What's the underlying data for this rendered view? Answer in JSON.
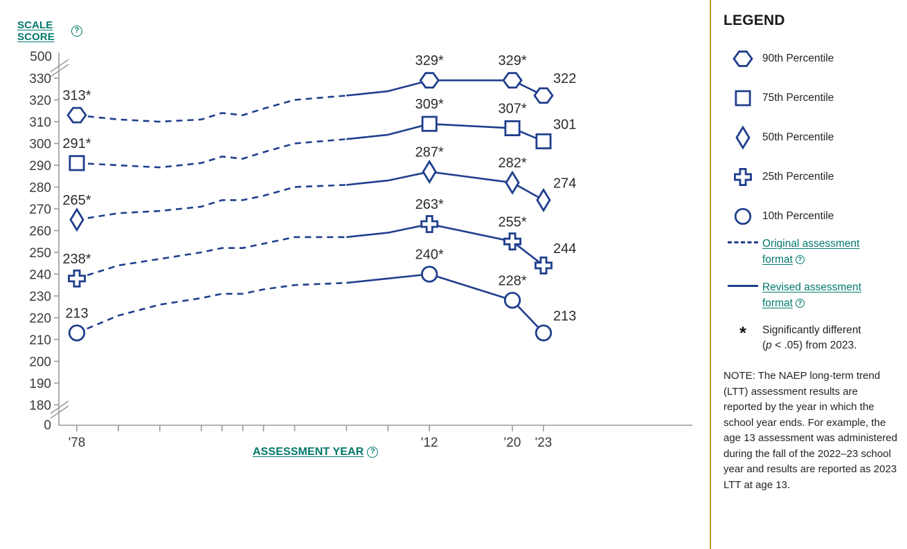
{
  "yaxis": {
    "title_line1": "SCALE",
    "title_line2": "SCORE",
    "help_icon": "question-circle-icon"
  },
  "xaxis": {
    "title": "ASSESSMENT YEAR",
    "help_icon": "question-circle-icon"
  },
  "legend": {
    "title": "LEGEND",
    "markers": [
      {
        "label": "90th Percentile",
        "shape": "hexagon"
      },
      {
        "label": "75th Percentile",
        "shape": "square"
      },
      {
        "label": "50th Percentile",
        "shape": "diamond"
      },
      {
        "label": "25th Percentile",
        "shape": "cross"
      },
      {
        "label": "10th Percentile",
        "shape": "circle"
      }
    ],
    "formats": [
      {
        "label_line1": "Original assessment",
        "label_line2": "format",
        "style": "dashed"
      },
      {
        "label_line1": "Revised assessment",
        "label_line2": "format",
        "style": "solid"
      }
    ],
    "significance": {
      "symbol": "*",
      "line1": "Significantly different",
      "line2_pre": "(",
      "line2_em": "p",
      "line2_post": " < .05) from 2023."
    },
    "note": "NOTE: The NAEP long-term trend (LTT) assessment results are reported by the year in which the school year ends. For example, the age 13 assessment was administered during the fall of the 2022–23 school year and results are reported as 2023 LTT at age 13."
  },
  "colors": {
    "series": "#1F3E8C",
    "axis": "#9a9a9a",
    "tick_label": "#3a3a3a",
    "data_label": "#2b2b2b",
    "link": "#00786B",
    "legend_border": "#C69A2E"
  },
  "chart_data": {
    "type": "line",
    "title": "",
    "xlabel": "ASSESSMENT YEAR",
    "ylabel": "SCALE SCORE",
    "ylim": [
      180,
      330
    ],
    "y_ticks": [
      330,
      320,
      310,
      300,
      290,
      280,
      270,
      260,
      250,
      240,
      230,
      220,
      210,
      200,
      190,
      180
    ],
    "y_top_label": "500",
    "y_zero_label": "0",
    "axis_breaks": [
      "between 500 and 330",
      "between 180 and 0"
    ],
    "grid": false,
    "legend_position": "right",
    "x_tick_labels": [
      "'78",
      "'12",
      "'20",
      "'23"
    ],
    "x_labeled_years": [
      1978,
      2012,
      2020,
      2023
    ],
    "series": [
      {
        "name": "90th Percentile",
        "shape": "hexagon",
        "points": [
          {
            "year": 1978,
            "value": 313,
            "label": "313*",
            "sig": true,
            "marker": true,
            "format": "original"
          },
          {
            "year": 1982,
            "value": 311,
            "format": "original"
          },
          {
            "year": 1986,
            "value": 310,
            "format": "original"
          },
          {
            "year": 1990,
            "value": 311,
            "format": "original"
          },
          {
            "year": 1992,
            "value": 314,
            "format": "original"
          },
          {
            "year": 1994,
            "value": 313,
            "format": "original"
          },
          {
            "year": 1996,
            "value": 316,
            "format": "original"
          },
          {
            "year": 1999,
            "value": 320,
            "format": "original"
          },
          {
            "year": 2004,
            "value": 322,
            "format": "revised"
          },
          {
            "year": 2008,
            "value": 324,
            "format": "revised"
          },
          {
            "year": 2012,
            "value": 329,
            "label": "329*",
            "sig": true,
            "marker": true,
            "format": "revised"
          },
          {
            "year": 2020,
            "value": 329,
            "label": "329*",
            "sig": true,
            "marker": true,
            "format": "revised"
          },
          {
            "year": 2023,
            "value": 322,
            "label": "322",
            "sig": false,
            "marker": true,
            "format": "revised"
          }
        ]
      },
      {
        "name": "75th Percentile",
        "shape": "square",
        "points": [
          {
            "year": 1978,
            "value": 291,
            "label": "291*",
            "sig": true,
            "marker": true,
            "format": "original"
          },
          {
            "year": 1982,
            "value": 290,
            "format": "original"
          },
          {
            "year": 1986,
            "value": 289,
            "format": "original"
          },
          {
            "year": 1990,
            "value": 291,
            "format": "original"
          },
          {
            "year": 1992,
            "value": 294,
            "format": "original"
          },
          {
            "year": 1994,
            "value": 293,
            "format": "original"
          },
          {
            "year": 1996,
            "value": 296,
            "format": "original"
          },
          {
            "year": 1999,
            "value": 300,
            "format": "original"
          },
          {
            "year": 2004,
            "value": 302,
            "format": "revised"
          },
          {
            "year": 2008,
            "value": 304,
            "format": "revised"
          },
          {
            "year": 2012,
            "value": 309,
            "label": "309*",
            "sig": true,
            "marker": true,
            "format": "revised"
          },
          {
            "year": 2020,
            "value": 307,
            "label": "307*",
            "sig": true,
            "marker": true,
            "format": "revised"
          },
          {
            "year": 2023,
            "value": 301,
            "label": "301",
            "sig": false,
            "marker": true,
            "format": "revised"
          }
        ]
      },
      {
        "name": "50th Percentile",
        "shape": "diamond",
        "points": [
          {
            "year": 1978,
            "value": 265,
            "label": "265*",
            "sig": true,
            "marker": true,
            "format": "original"
          },
          {
            "year": 1982,
            "value": 268,
            "format": "original"
          },
          {
            "year": 1986,
            "value": 269,
            "format": "original"
          },
          {
            "year": 1990,
            "value": 271,
            "format": "original"
          },
          {
            "year": 1992,
            "value": 274,
            "format": "original"
          },
          {
            "year": 1994,
            "value": 274,
            "format": "original"
          },
          {
            "year": 1996,
            "value": 276,
            "format": "original"
          },
          {
            "year": 1999,
            "value": 280,
            "format": "original"
          },
          {
            "year": 2004,
            "value": 281,
            "format": "revised"
          },
          {
            "year": 2008,
            "value": 283,
            "format": "revised"
          },
          {
            "year": 2012,
            "value": 287,
            "label": "287*",
            "sig": true,
            "marker": true,
            "format": "revised"
          },
          {
            "year": 2020,
            "value": 282,
            "label": "282*",
            "sig": true,
            "marker": true,
            "format": "revised"
          },
          {
            "year": 2023,
            "value": 274,
            "label": "274",
            "sig": false,
            "marker": true,
            "format": "revised"
          }
        ]
      },
      {
        "name": "25th Percentile",
        "shape": "cross",
        "points": [
          {
            "year": 1978,
            "value": 238,
            "label": "238*",
            "sig": true,
            "marker": true,
            "format": "original"
          },
          {
            "year": 1982,
            "value": 244,
            "format": "original"
          },
          {
            "year": 1986,
            "value": 247,
            "format": "original"
          },
          {
            "year": 1990,
            "value": 250,
            "format": "original"
          },
          {
            "year": 1992,
            "value": 252,
            "format": "original"
          },
          {
            "year": 1994,
            "value": 252,
            "format": "original"
          },
          {
            "year": 1996,
            "value": 254,
            "format": "original"
          },
          {
            "year": 1999,
            "value": 257,
            "format": "original"
          },
          {
            "year": 2004,
            "value": 257,
            "format": "revised"
          },
          {
            "year": 2008,
            "value": 259,
            "format": "revised"
          },
          {
            "year": 2012,
            "value": 263,
            "label": "263*",
            "sig": true,
            "marker": true,
            "format": "revised"
          },
          {
            "year": 2020,
            "value": 255,
            "label": "255*",
            "sig": true,
            "marker": true,
            "format": "revised"
          },
          {
            "year": 2023,
            "value": 244,
            "label": "244",
            "sig": false,
            "marker": true,
            "format": "revised"
          }
        ]
      },
      {
        "name": "10th Percentile",
        "shape": "circle",
        "points": [
          {
            "year": 1978,
            "value": 213,
            "label": "213",
            "sig": false,
            "marker": true,
            "format": "original"
          },
          {
            "year": 1982,
            "value": 221,
            "format": "original"
          },
          {
            "year": 1986,
            "value": 226,
            "format": "original"
          },
          {
            "year": 1990,
            "value": 229,
            "format": "original"
          },
          {
            "year": 1992,
            "value": 231,
            "format": "original"
          },
          {
            "year": 1994,
            "value": 231,
            "format": "original"
          },
          {
            "year": 1996,
            "value": 233,
            "format": "original"
          },
          {
            "year": 1999,
            "value": 235,
            "format": "original"
          },
          {
            "year": 2004,
            "value": 236,
            "format": "revised"
          },
          {
            "year": 2008,
            "value": 238,
            "format": "revised"
          },
          {
            "year": 2012,
            "value": 240,
            "label": "240*",
            "sig": true,
            "marker": true,
            "format": "revised"
          },
          {
            "year": 2020,
            "value": 228,
            "label": "228*",
            "sig": true,
            "marker": true,
            "format": "revised"
          },
          {
            "year": 2023,
            "value": 213,
            "label": "213",
            "sig": false,
            "marker": true,
            "format": "revised"
          }
        ]
      }
    ]
  }
}
